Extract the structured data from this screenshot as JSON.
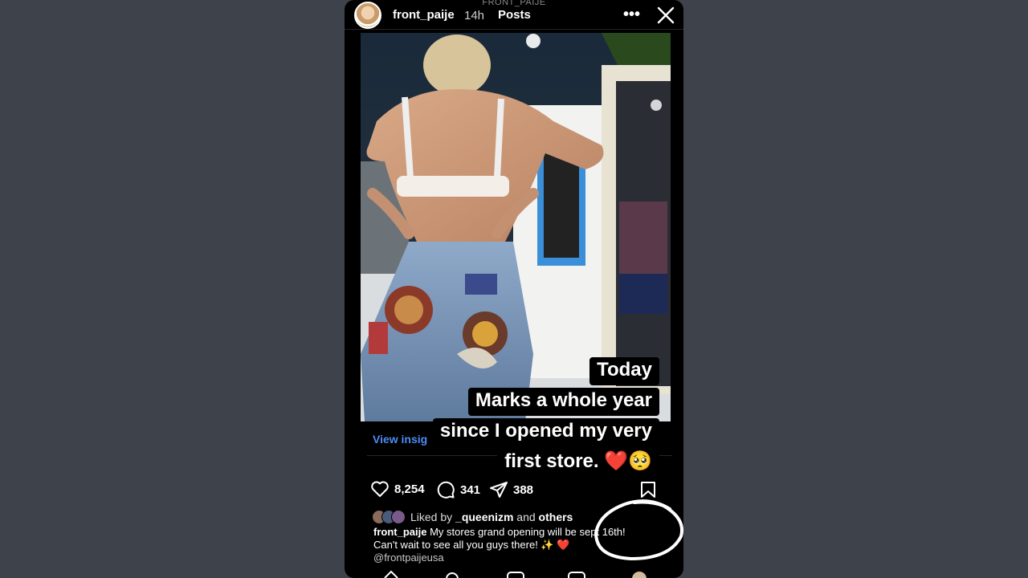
{
  "header": {
    "ghost_title": "FRONT_PAIJE",
    "username": "front_paije",
    "time": "14h",
    "section": "Posts"
  },
  "overlay_caption": {
    "lines": [
      "Today",
      "Marks a whole year",
      "since I opened my very",
      "first store. ❤️🥺"
    ]
  },
  "post": {
    "view_insights": "View insig",
    "likes": "8,254",
    "comments": "341",
    "shares": "388",
    "liked_by_prefix": "Liked by",
    "liked_by_user": "_queenizm",
    "liked_by_and": "and",
    "liked_by_others": "others",
    "caption_user": "front_paije",
    "caption_text_1": "My stores grand opening will be sept 16th!",
    "caption_text_2": "Can't wait to see all you guys there! ✨ ❤️",
    "caption_tag": "@frontpaijeusa"
  },
  "colors": {
    "background": "#3d424b",
    "link": "#4d8cf5"
  }
}
